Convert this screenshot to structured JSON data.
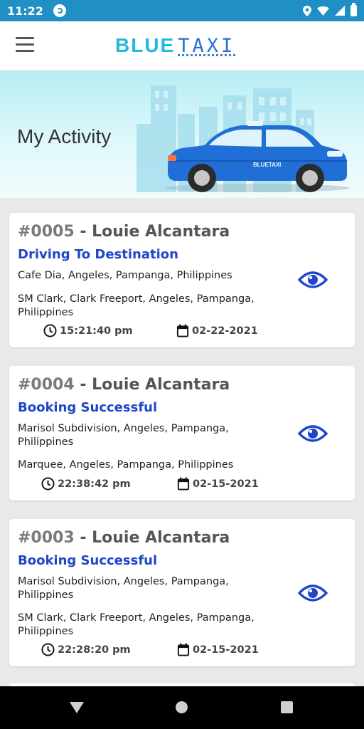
{
  "status_bar": {
    "time": "11:22"
  },
  "app_bar": {
    "brand_blue": "BLUE",
    "brand_taxi": "TAXI"
  },
  "hero": {
    "title": "My Activity",
    "car_label": "BLUETAXI"
  },
  "colors": {
    "accent": "#1f46c8",
    "brand_cyan": "#22b8e0",
    "status_bar": "#1f8fc6"
  },
  "activities": [
    {
      "id": "#0005",
      "separator": " - ",
      "name": "Louie Alcantara",
      "status": "Driving To Destination",
      "pickup": "Cafe Dia, Angeles, Pampanga, Philippines",
      "dropoff": "SM Clark, Clark Freeport, Angeles, Pampanga, Philippines",
      "time": "15:21:40 pm",
      "date": "02-22-2021"
    },
    {
      "id": "#0004",
      "separator": " - ",
      "name": "Louie Alcantara",
      "status": "Booking Successful",
      "pickup": "Marisol Subdivision, Angeles, Pampanga, Philippines",
      "dropoff": "Marquee, Angeles, Pampanga, Philippines",
      "time": "22:38:42 pm",
      "date": "02-15-2021"
    },
    {
      "id": "#0003",
      "separator": " - ",
      "name": "Louie Alcantara",
      "status": "Booking Successful",
      "pickup": "Marisol Subdivision, Angeles, Pampanga, Philippines",
      "dropoff": "SM Clark, Clark Freeport, Angeles, Pampanga, Philippines",
      "time": "22:28:20 pm",
      "date": "02-15-2021"
    }
  ]
}
